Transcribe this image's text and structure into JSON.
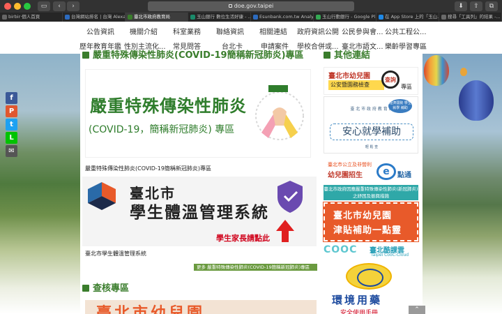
{
  "browser": {
    "url": "doe.gov.taipei",
    "tabs": [
      {
        "label": "birbir·個人首頁",
        "color": "#666666"
      },
      {
        "label": "台灣網站排名 | 台灣 Alexa ...",
        "color": "#2c6bbf"
      },
      {
        "label": "臺北市政府教育局",
        "color": "#3a7d2c"
      },
      {
        "label": "玉山銀行 數位生活好康 - ...",
        "color": "#1a8a6a"
      },
      {
        "label": "Esunbank.com.tw Analyti...",
        "color": "#2c6bbf"
      },
      {
        "label": "玉山行動銀行 - Google Pl...",
        "color": "#34a853"
      },
      {
        "label": "在 App Store 上的「玉山...",
        "color": "#1e88e5"
      },
      {
        "label": "搜尋「工具列」的結果 -...",
        "color": "#6a6a6a"
      }
    ],
    "active_tab": 2
  },
  "nav": {
    "row1": [
      "公告資訊",
      "機關介紹",
      "科室業務",
      "聯絡資訊",
      "相關連結",
      "政府資訊公開",
      "公民參與會...",
      "公共工程公..."
    ],
    "row2": [
      "歷年教育年鑑",
      "性別主流化...",
      "常見問答",
      "台北卡",
      "申請案件",
      "學校合併或...",
      "臺北市語文...",
      "樂齡學習專區"
    ]
  },
  "share": [
    {
      "name": "facebook",
      "label": "f",
      "color": "#3b5998"
    },
    {
      "name": "plurk",
      "label": "P",
      "color": "#e0572f"
    },
    {
      "name": "twitter",
      "label": "t",
      "color": "#1da1f2"
    },
    {
      "name": "line",
      "label": "L",
      "color": "#00c300"
    },
    {
      "name": "email",
      "label": "✉",
      "color": "#555555"
    }
  ],
  "main": {
    "covid_section_title": "嚴重特殊傳染性肺炎(COVID-19簡稱新冠肺炎)專區",
    "covid_banner": {
      "title": "嚴重特殊傳染性肺炎",
      "subtitle": "(COVID-19，簡稱新冠肺炎) 專區"
    },
    "covid_caption": "嚴重特殊傳染性肺炎(COVID-19簡稱新冠肺炎)專區",
    "temp_banner": {
      "city": "臺北市",
      "name": "學生體溫管理系統",
      "link": "學生家長請點此"
    },
    "temp_caption": "臺北市學生體溫管理系統",
    "more_link": "更多 嚴重特殊傳染性肺炎(COVID-19簡稱新冠肺炎)專區",
    "audit_section_title": "查核專區",
    "bottom_banner_text": "臺北市幼兒園"
  },
  "sidebar": {
    "section_title": "其他連結",
    "items": {
      "kindergarten_check": {
        "title": "臺北市幼兒園",
        "tag": "公安暨園務檢查",
        "magnify": "查詢",
        "suffix": "專區"
      },
      "subsidy": {
        "org": "臺 北 市 政 府 教 育 局",
        "badge": "經濟弱勢 學生就學 補助",
        "title": "安心就學補助",
        "note": "輕 鬆 查"
      },
      "enroll": {
        "line1": "臺北市公立及非營利",
        "line2": "幼兒園招生",
        "e": "e",
        "line3": "點通"
      },
      "covid_notice": "臺北市政府因應嚴重特殊傳染性肺炎(新冠肺炎)之紓困及振興措施",
      "allowance": {
        "line1": "臺北市幼兒園",
        "line2": "津貼補助一點靈"
      },
      "cooc": {
        "logo": "COOC",
        "title": "臺北酷課雲",
        "sub": "Taipei CooC-Cloud"
      },
      "env": {
        "title": "環境用藥",
        "sub": "安全使用手冊"
      }
    }
  },
  "scroll_top_label": "⌃"
}
